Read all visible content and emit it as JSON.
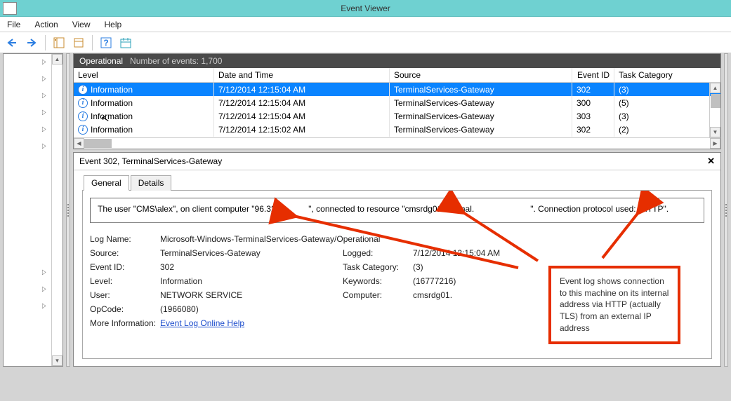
{
  "window": {
    "title": "Event Viewer"
  },
  "menu": {
    "file": "File",
    "action": "Action",
    "view": "View",
    "help": "Help"
  },
  "panel1": {
    "title": "Operational",
    "subtitle": "Number of events: 1,700",
    "columns": {
      "level": "Level",
      "date": "Date and Time",
      "source": "Source",
      "eventid": "Event ID",
      "task": "Task Category"
    },
    "rows": [
      {
        "level": "Information",
        "date": "7/12/2014 12:15:04 AM",
        "source": "TerminalServices-Gateway",
        "eventid": "302",
        "task": "(3)"
      },
      {
        "level": "Information",
        "date": "7/12/2014 12:15:04 AM",
        "source": "TerminalServices-Gateway",
        "eventid": "300",
        "task": "(5)"
      },
      {
        "level": "Information",
        "date": "7/12/2014 12:15:04 AM",
        "source": "TerminalServices-Gateway",
        "eventid": "303",
        "task": "(3)"
      },
      {
        "level": "Information",
        "date": "7/12/2014 12:15:02 AM",
        "source": "TerminalServices-Gateway",
        "eventid": "302",
        "task": "(2)"
      }
    ]
  },
  "detail": {
    "title": "Event 302, TerminalServices-Gateway",
    "tabs": {
      "general": "General",
      "details": "Details"
    },
    "message": "The user \"CMS\\alex\", on client computer \"96.32.2           \", connected to resource \"cmsrdg01.internal.                        \". Connection protocol used: \"HTTP\".",
    "fields": {
      "logname_l": "Log Name:",
      "logname_v": "Microsoft-Windows-TerminalServices-Gateway/Operational",
      "source_l": "Source:",
      "source_v": "TerminalServices-Gateway",
      "logged_l": "Logged:",
      "logged_v": "7/12/2014 12:15:04 AM",
      "eventid_l": "Event ID:",
      "eventid_v": "302",
      "taskcat_l": "Task Category:",
      "taskcat_v": "(3)",
      "level_l": "Level:",
      "level_v": "Information",
      "keywords_l": "Keywords:",
      "keywords_v": "(16777216)",
      "user_l": "User:",
      "user_v": "NETWORK SERVICE",
      "computer_l": "Computer:",
      "computer_v": "cmsrdg01.",
      "opcode_l": "OpCode:",
      "opcode_v": "(1966080)",
      "moreinfo_l": "More Information:",
      "moreinfo_link": "Event Log Online Help"
    }
  },
  "annotation": "Event log shows connection to this machine on its internal address via HTTP (actually TLS)  from an external IP address"
}
